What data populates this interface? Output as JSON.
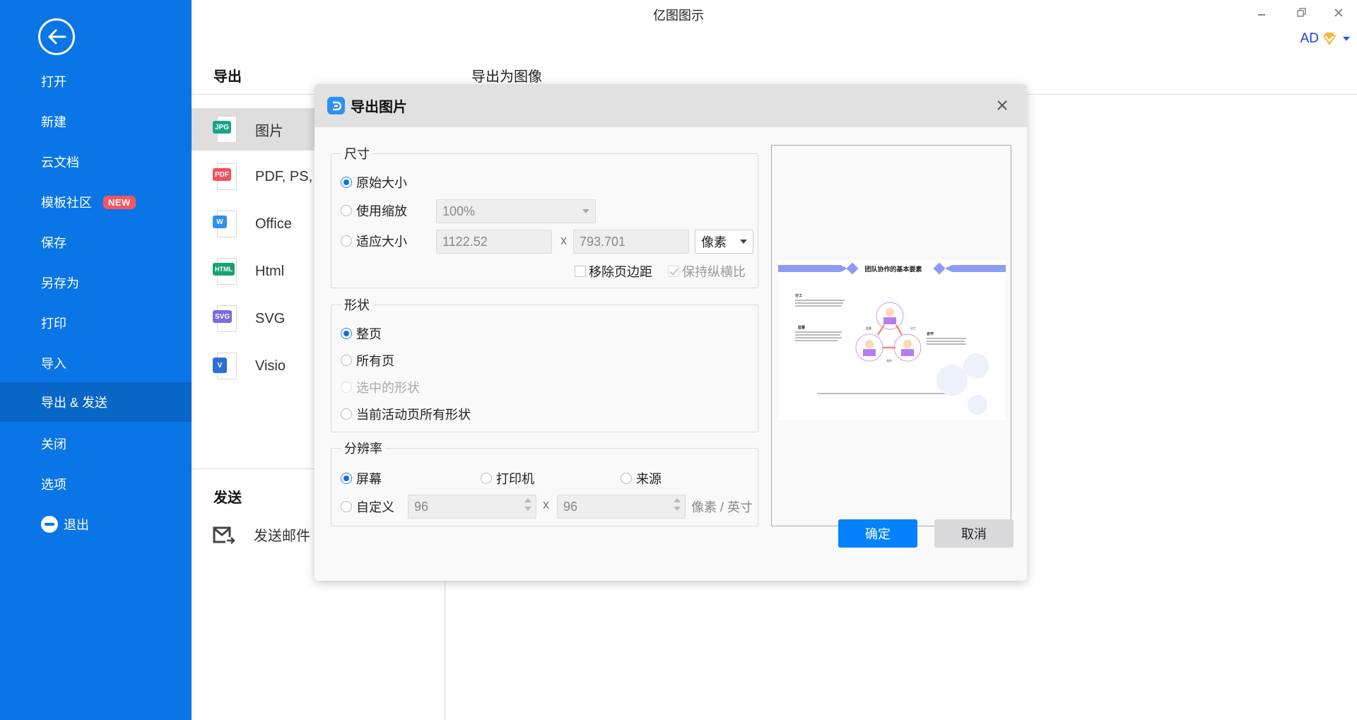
{
  "window": {
    "title": "亿图图示",
    "minimize_icon": "minimize-icon",
    "restore_icon": "restore-icon",
    "close_icon": "close-icon",
    "user": {
      "name": "AD",
      "vip_icon": "vip-diamond-icon"
    }
  },
  "sidebar": {
    "back_icon": "back-arrow-icon",
    "items": [
      {
        "label": "打开"
      },
      {
        "label": "新建"
      },
      {
        "label": "云文档"
      },
      {
        "label": "模板社区",
        "badge": "NEW"
      },
      {
        "label": "保存"
      },
      {
        "label": "另存为"
      },
      {
        "label": "打印"
      },
      {
        "label": "导入"
      },
      {
        "label": "导出 & 发送",
        "active": true
      },
      {
        "label": "关闭"
      },
      {
        "label": "选项"
      },
      {
        "label": "退出",
        "icon": "exit-icon"
      }
    ]
  },
  "export_page": {
    "export_heading": "导出",
    "subtitle": "导出为图像",
    "formats": [
      {
        "tag": "JPG",
        "label": "图片",
        "color": "#1aa58a",
        "active": true
      },
      {
        "tag": "PDF",
        "label": "PDF, PS,",
        "color": "#f2525a"
      },
      {
        "tag": "W",
        "label": "Office",
        "color": "#2f8ef4"
      },
      {
        "tag": "HTML",
        "label": "Html",
        "color": "#1aa071"
      },
      {
        "tag": "SVG",
        "label": "SVG",
        "color": "#7b6ae0"
      },
      {
        "tag": "V",
        "label": "Visio",
        "color": "#2c6fd6"
      }
    ],
    "send_heading": "发送",
    "send_items": [
      {
        "label": "发送邮件",
        "icon": "mail-send-icon"
      }
    ]
  },
  "dialog": {
    "title": "导出图片",
    "size_group": {
      "legend": "尺寸",
      "options": [
        "原始大小",
        "使用缩放",
        "适应大小"
      ],
      "selected": "原始大小",
      "zoom_value": "100%",
      "width_value": "1122.52",
      "height_value": "793.701",
      "x_sep": "x",
      "unit_selected": "像素",
      "remove_margin_label": "移除页边距",
      "remove_margin_checked": false,
      "keep_ratio_label": "保持纵横比",
      "keep_ratio_checked": true
    },
    "shape_group": {
      "legend": "形状",
      "options": [
        "整页",
        "所有页",
        "选中的形状",
        "当前活动页所有形状"
      ],
      "selected": "整页"
    },
    "resolution_group": {
      "legend": "分辨率",
      "options": [
        "屏幕",
        "打印机",
        "来源",
        "自定义"
      ],
      "selected": "屏幕",
      "custom_x": "96",
      "custom_y": "96",
      "x_sep": "x",
      "unit": "像素 / 英寸"
    },
    "preview": {
      "title": "团队协作的基本要素",
      "nodes": [
        "分工",
        "监督",
        "合作"
      ],
      "arrow_labels": [
        "监督",
        "分工",
        "合作"
      ],
      "accent_color": "#8c9cf5",
      "person_color": "#b57ef0",
      "arrow_color": "#f58a70"
    },
    "ok_label": "确定",
    "cancel_label": "取消"
  }
}
